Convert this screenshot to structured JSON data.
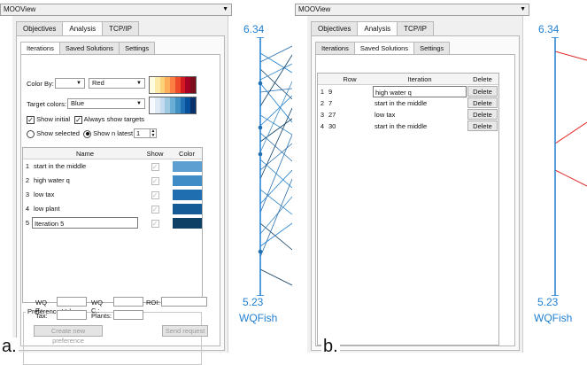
{
  "panel_a": {
    "letter": "a.",
    "window_title": "MOOView",
    "tabs": [
      "Objectives",
      "Analysis",
      "TCP/IP"
    ],
    "subtabs": [
      "Iterations",
      "Saved Solutions",
      "Settings"
    ],
    "color_by_label": "Color By:",
    "color_by_value": "",
    "color_scheme_value": "Red",
    "target_colors_label": "Target colors:",
    "target_colors_value": "Blue",
    "show_initial_label": "Show initial",
    "always_show_targets_label": "Always show targets",
    "show_selected_label": "Show selected",
    "show_n_latest_label": "Show n latest",
    "n_latest_value": "1",
    "table": {
      "headers": [
        "Name",
        "Show",
        "Color"
      ],
      "rows": [
        {
          "num": "1",
          "name": "start in the middle",
          "color": "#5c9fd0"
        },
        {
          "num": "2",
          "name": "high water q",
          "color": "#3f8cc6"
        },
        {
          "num": "3",
          "name": "low tax",
          "color": "#1f6fb0"
        },
        {
          "num": "4",
          "name": "low plant",
          "color": "#155b96"
        },
        {
          "num": "5",
          "name": "Iteration 5",
          "color": "#0e3f64"
        }
      ]
    },
    "preferences": {
      "title": "Preference Values",
      "wq_f_label": "WQ F.:",
      "wq_c_label": "WQ C.:",
      "roi_label": "ROI:",
      "tax_label": "Tax:",
      "plants_label": "Plants:",
      "create_button": "Create new preference",
      "send_button": "Send request"
    },
    "axis": {
      "top": "6.34",
      "bottom": "5.23",
      "name": "WQFish"
    },
    "red_palette": [
      "#fffbe0",
      "#fde9a8",
      "#fdd07a",
      "#fcae5a",
      "#f97f42",
      "#ee4a2c",
      "#d31b22",
      "#a50026",
      "#7c0d1a"
    ],
    "blue_palette": [
      "#f7fbff",
      "#deebf7",
      "#c6dbef",
      "#9ecae1",
      "#6baed6",
      "#4292c6",
      "#2171b5",
      "#08519c",
      "#08306b"
    ]
  },
  "panel_b": {
    "letter": "b.",
    "window_title": "MOOView",
    "tabs": [
      "Objectives",
      "Analysis",
      "TCP/IP"
    ],
    "subtabs": [
      "Iterations",
      "Saved Solutions",
      "Settings"
    ],
    "table": {
      "headers": [
        "Row",
        "Iteration",
        "Delete"
      ],
      "rows": [
        {
          "num": "1",
          "row": "9",
          "iteration": "high water q",
          "delete": "Delete"
        },
        {
          "num": "2",
          "row": "7",
          "iteration": "start in the middle",
          "delete": "Delete"
        },
        {
          "num": "3",
          "row": "27",
          "iteration": "low tax",
          "delete": "Delete"
        },
        {
          "num": "4",
          "row": "30",
          "iteration": "start in the middle",
          "delete": "Delete"
        }
      ]
    },
    "axis": {
      "top": "6.34",
      "bottom": "5.23",
      "name": "WQFish"
    }
  }
}
